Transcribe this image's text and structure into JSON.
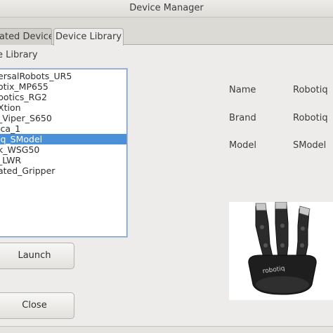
{
  "window": {
    "title": "Device Manager"
  },
  "tabs": [
    {
      "label": "ated Devices",
      "active": false
    },
    {
      "label": "Device Library",
      "active": true
    }
  ],
  "library": {
    "heading": "e Library",
    "items": [
      {
        "label": "ersalRobots_UR5",
        "selected": false
      },
      {
        "label": "otix_MP655",
        "selected": false
      },
      {
        "label": "botics_RG2",
        "selected": false
      },
      {
        "label": "Xtion",
        "selected": false
      },
      {
        "label": "_Viper_S650",
        "selected": false
      },
      {
        "label": "ica_1",
        "selected": false
      },
      {
        "label": "iq_SModel",
        "selected": true
      },
      {
        "label": "k_WSG50",
        "selected": false
      },
      {
        "label": "_LWR",
        "selected": false
      },
      {
        "label": "ated_Gripper",
        "selected": false
      }
    ]
  },
  "details": {
    "name_label": "Name",
    "name_value": "Robotiq",
    "brand_label": "Brand",
    "brand_value": "Robotiq",
    "model_label": "Model",
    "model_value": "SModel",
    "image_brand_text": "robotiq"
  },
  "buttons": {
    "launch": "Launch",
    "close": "Close"
  },
  "colors": {
    "selection": "#4a90d9",
    "window_bg": "#edecea"
  }
}
